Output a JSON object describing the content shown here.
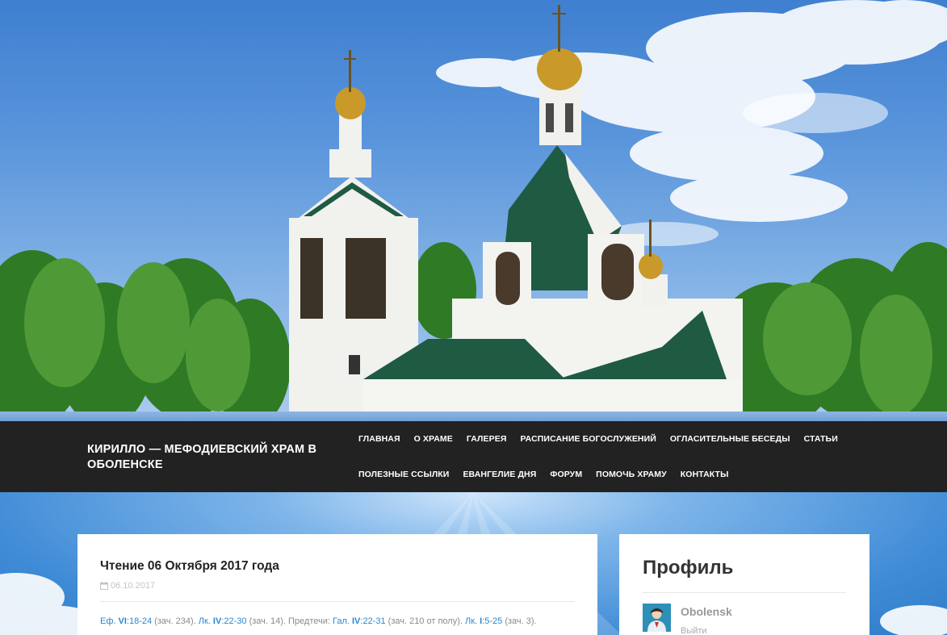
{
  "header": {
    "site_title": "КИРИЛЛО — МЕФОДИЕВСКИЙ ХРАМ В ОБОЛЕНСКЕ"
  },
  "menu": {
    "row1": [
      "ГЛАВНАЯ",
      "О ХРАМЕ",
      "ГАЛЕРЕЯ",
      "РАСПИСАНИЕ БОГОСЛУЖЕНИЙ",
      "ОГЛАСИТЕЛЬНЫЕ БЕСЕДЫ",
      "СТАТЬИ"
    ],
    "row2": [
      "ПОЛЕЗНЫЕ ССЫЛКИ",
      "ЕВАНГЕЛИЕ ДНЯ",
      "ФОРУМ",
      "ПОМОЧЬ ХРАМУ",
      "КОНТАКТЫ"
    ]
  },
  "post": {
    "title": "Чтение 06 Октября 2017 года",
    "date": "06.10.2017",
    "reading": {
      "r1_book": "Еф.",
      "r1_ch": "VI",
      "r1_verses": ":18-24",
      "r1_note": " (зач. 234). ",
      "r2_book": "Лк.",
      "r2_ch": "IV",
      "r2_verses": ":22-30",
      "r2_note": " (зач. 14). Предтечи: ",
      "r3_book": "Гал.",
      "r3_ch": "IV",
      "r3_verses": ":22-31",
      "r3_note": " (зач. 210 от полу). ",
      "r4_book": "Лк.",
      "r4_ch": "I",
      "r4_verses": ":5-25",
      "r4_note": " (зач. 3)."
    }
  },
  "sidebar": {
    "title": "Профиль",
    "user_name": "Obolensk",
    "logout_label": "Выйти"
  },
  "icons": {
    "date": "calendar-icon",
    "avatar": "user-avatar-icon"
  },
  "colors": {
    "navbar_bg": "#222222",
    "link": "#2a86d1",
    "card_bg": "#ffffff"
  }
}
